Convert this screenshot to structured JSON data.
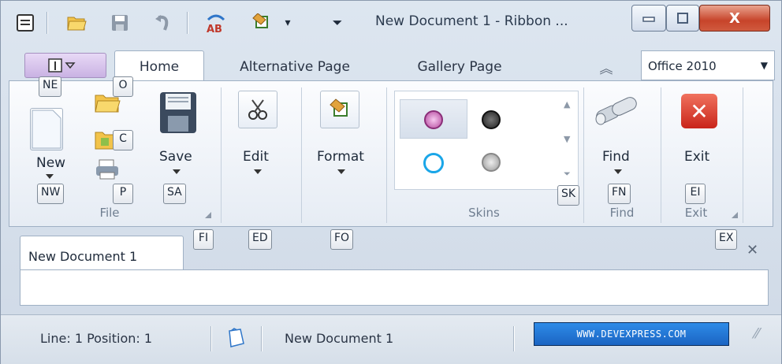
{
  "window": {
    "title": "New Document 1 - Ribbon ...",
    "minimize_glyph": "▭",
    "maximize_glyph": "◻",
    "close_glyph": "X"
  },
  "quick_access": {
    "items": [
      "document-icon",
      "open-folder-icon",
      "save-disk-icon",
      "undo-icon",
      "spellcheck-icon",
      "paint-bucket-icon"
    ],
    "dropdown_glyph": "▾",
    "customize_glyph": "⏷",
    "spell_text": "AB"
  },
  "tabs": [
    {
      "label": "Home",
      "active": true
    },
    {
      "label": "Alternative Page",
      "active": false
    },
    {
      "label": "Gallery Page",
      "active": false
    }
  ],
  "minimize_ribbon_glyph": "︽",
  "skin_select": {
    "value": "Office 2010",
    "arrow": "▼"
  },
  "ribbon": {
    "groups": {
      "file": "File",
      "skins": "Skins",
      "find": "Find",
      "exit": "Exit"
    },
    "buttons": {
      "new": "New",
      "save": "Save",
      "edit": "Edit",
      "format": "Format",
      "find": "Find",
      "exit": "Exit"
    }
  },
  "keytips": {
    "app_menu": "NE",
    "open": "O",
    "close": "C",
    "new": "NW",
    "print": "P",
    "save": "SA",
    "file_group": "FI",
    "edit": "ED",
    "format": "FO",
    "skins": "SK",
    "find": "FN",
    "exit": "EI",
    "exit_group": "EX"
  },
  "document": {
    "tab_label": "New Document 1",
    "close_glyph": "✕"
  },
  "statusbar": {
    "line_position": "Line: 1  Position: 1",
    "doc_name": "New Document 1",
    "link_text": "WWW.DEVEXPRESS.COM"
  },
  "colors": {
    "accent": "#1b64c2",
    "app_menu": "#c9b2e3",
    "close_button": "#c7442a"
  }
}
